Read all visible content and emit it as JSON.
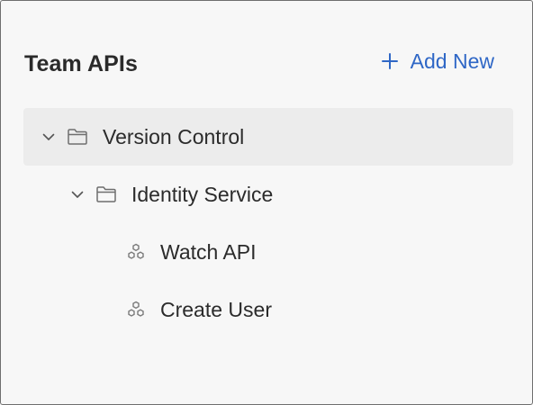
{
  "header": {
    "title": "Team APIs",
    "add_new_label": "Add New"
  },
  "tree": {
    "root": {
      "label": "Version Control",
      "expanded": true,
      "selected": true,
      "icon": "folder-icon"
    },
    "child": {
      "label": "Identity Service",
      "expanded": true,
      "icon": "folder-icon"
    },
    "endpoints": [
      {
        "label": "Watch API",
        "icon": "api-node-icon"
      },
      {
        "label": "Create User",
        "icon": "api-node-icon"
      }
    ]
  },
  "colors": {
    "accent": "#2f67c6",
    "selected_bg": "#ececec",
    "panel_bg": "#f7f7f7",
    "text": "#2b2b2b",
    "icon": "#7a7a7a"
  }
}
